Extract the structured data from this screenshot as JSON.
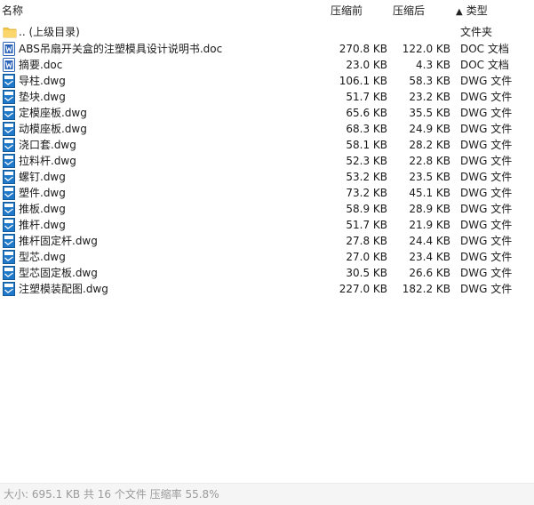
{
  "header": {
    "name": "名称",
    "before": "压缩前",
    "after": "压缩后",
    "type": "类型",
    "sort_indicator": "▲"
  },
  "parent_row": {
    "name": ".. (上级目录)",
    "type": "文件夹",
    "icon": "folder-icon"
  },
  "files": [
    {
      "name": "ABS吊扇开关盒的注塑模具设计说明书.doc",
      "before": "270.8 KB",
      "after": "122.0 KB",
      "type": "DOC 文档",
      "icon": "doc-icon"
    },
    {
      "name": "摘要.doc",
      "before": "23.0 KB",
      "after": "4.3 KB",
      "type": "DOC 文档",
      "icon": "doc-icon"
    },
    {
      "name": "导柱.dwg",
      "before": "106.1 KB",
      "after": "58.3 KB",
      "type": "DWG 文件",
      "icon": "dwg-icon"
    },
    {
      "name": "垫块.dwg",
      "before": "51.7 KB",
      "after": "23.2 KB",
      "type": "DWG 文件",
      "icon": "dwg-icon"
    },
    {
      "name": "定模座板.dwg",
      "before": "65.6 KB",
      "after": "35.5 KB",
      "type": "DWG 文件",
      "icon": "dwg-icon"
    },
    {
      "name": "动模座板.dwg",
      "before": "68.3 KB",
      "after": "24.9 KB",
      "type": "DWG 文件",
      "icon": "dwg-icon"
    },
    {
      "name": "浇口套.dwg",
      "before": "58.1 KB",
      "after": "28.2 KB",
      "type": "DWG 文件",
      "icon": "dwg-icon"
    },
    {
      "name": "拉料杆.dwg",
      "before": "52.3 KB",
      "after": "22.8 KB",
      "type": "DWG 文件",
      "icon": "dwg-icon"
    },
    {
      "name": "螺钉.dwg",
      "before": "53.2 KB",
      "after": "23.5 KB",
      "type": "DWG 文件",
      "icon": "dwg-icon"
    },
    {
      "name": "塑件.dwg",
      "before": "73.2 KB",
      "after": "45.1 KB",
      "type": "DWG 文件",
      "icon": "dwg-icon"
    },
    {
      "name": "推板.dwg",
      "before": "58.9 KB",
      "after": "28.9 KB",
      "type": "DWG 文件",
      "icon": "dwg-icon"
    },
    {
      "name": "推杆.dwg",
      "before": "51.7 KB",
      "after": "21.9 KB",
      "type": "DWG 文件",
      "icon": "dwg-icon"
    },
    {
      "name": "推杆固定杆.dwg",
      "before": "27.8 KB",
      "after": "24.4 KB",
      "type": "DWG 文件",
      "icon": "dwg-icon"
    },
    {
      "name": "型芯.dwg",
      "before": "27.0 KB",
      "after": "23.4 KB",
      "type": "DWG 文件",
      "icon": "dwg-icon"
    },
    {
      "name": "型芯固定板.dwg",
      "before": "30.5 KB",
      "after": "26.6 KB",
      "type": "DWG 文件",
      "icon": "dwg-icon"
    },
    {
      "name": "注塑模装配图.dwg",
      "before": "227.0 KB",
      "after": "182.2 KB",
      "type": "DWG 文件",
      "icon": "dwg-icon"
    }
  ],
  "status": {
    "text": "大小: 695.1 KB 共 16 个文件 压缩率 55.8%"
  },
  "colors": {
    "folder": "#f6c94e",
    "doc": "#2b63b8",
    "dwg": "#1f78c8",
    "status_text": "#9a9a9a"
  }
}
